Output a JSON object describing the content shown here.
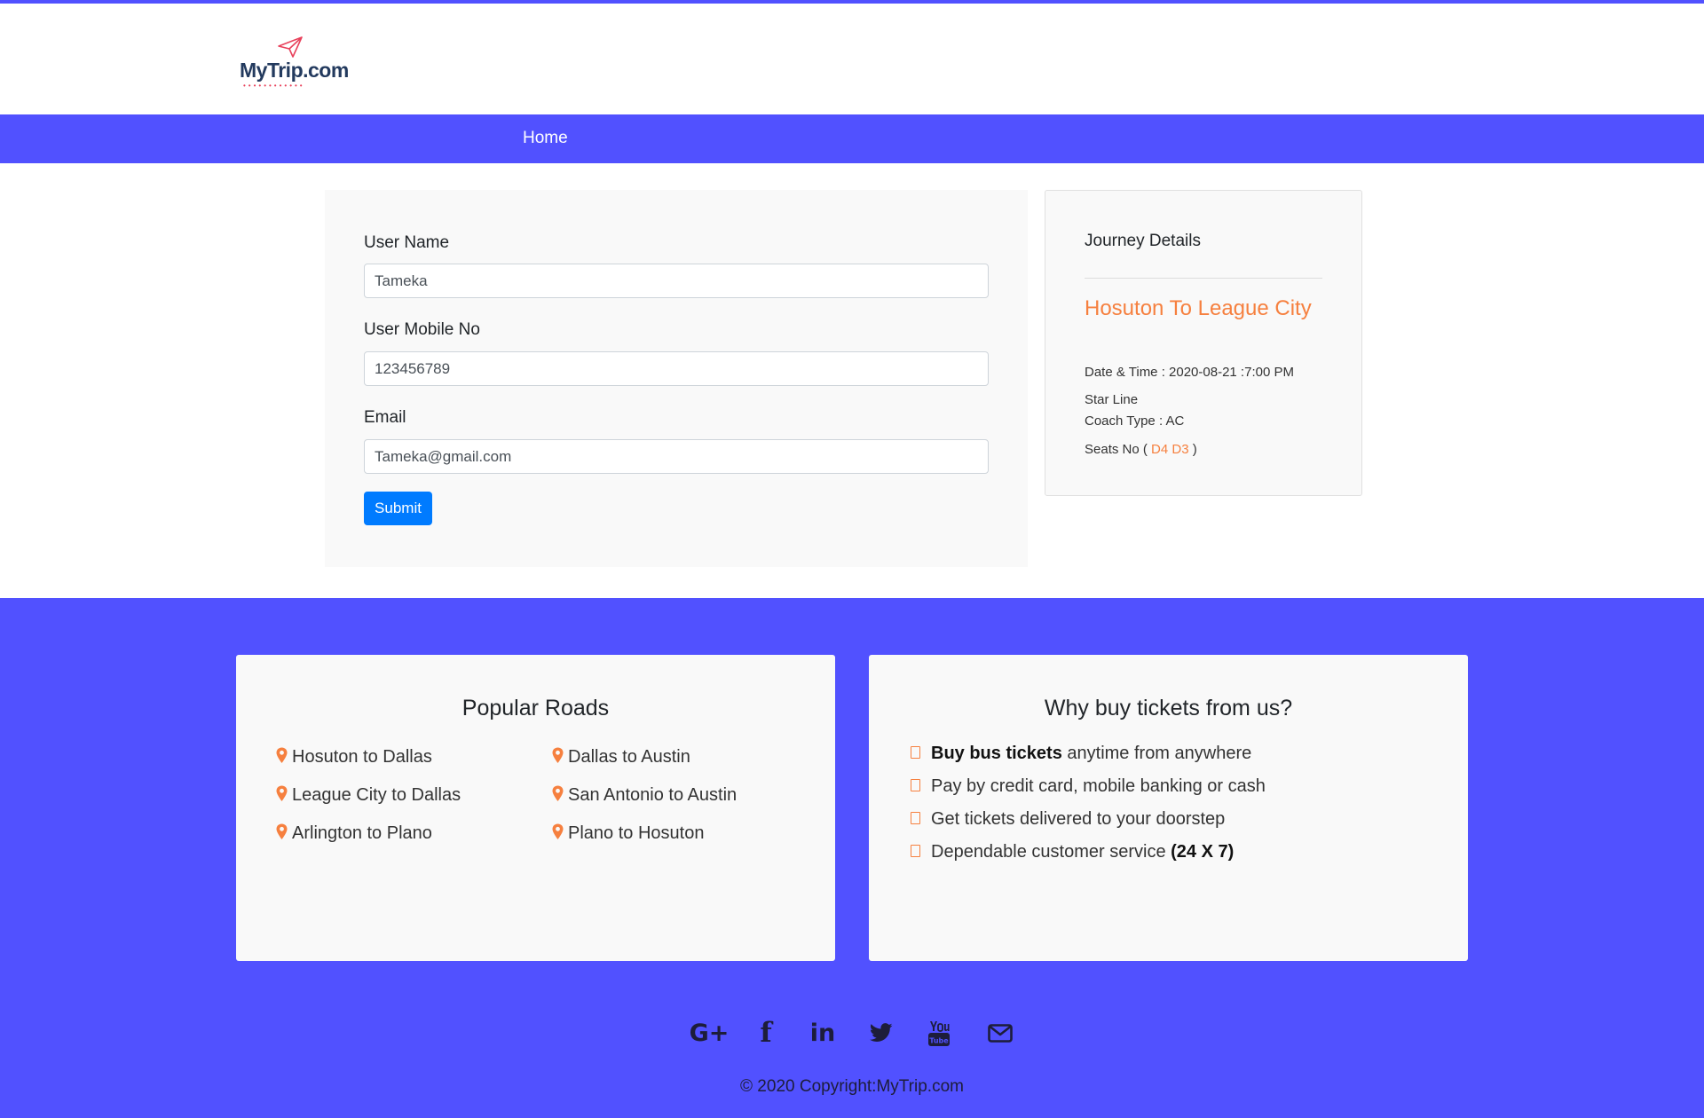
{
  "brand": {
    "logo_text": "MyTrip.com"
  },
  "nav": {
    "home_label": "Home"
  },
  "form": {
    "user_name_label": "User Name",
    "user_name_value": "Tameka",
    "mobile_label": "User Mobile No",
    "mobile_value": "123456789",
    "email_label": "Email",
    "email_value": "Tameka@gmail.com",
    "submit_label": "Submit"
  },
  "journey": {
    "title": "Journey Details",
    "route": "Hosuton To League City",
    "datetime": "Date & Time : 2020-08-21 :7:00 PM",
    "operator": "Star Line",
    "coach_type": "Coach Type : AC",
    "seats_prefix": "Seats No (",
    "seats": "D4 D3",
    "seats_suffix": ")"
  },
  "popular_roads": {
    "title": "Popular Roads",
    "items": [
      "Hosuton to Dallas",
      "Dallas to Austin",
      "League City to Dallas",
      "San Antonio to Austin",
      "Arlington to Plano",
      "Plano to Hosuton"
    ]
  },
  "why_us": {
    "title": "Why buy tickets from us?",
    "items": [
      {
        "bold": "Buy bus tickets",
        "text": " anytime from anywhere"
      },
      {
        "text": "Pay by credit card, mobile banking or cash"
      },
      {
        "text": "Get tickets delivered to your doorstep"
      },
      {
        "text": "Dependable customer service ",
        "bold_suffix": "(24 X 7)"
      }
    ]
  },
  "social": {
    "icons": [
      "google-plus-icon",
      "facebook-icon",
      "linkedin-icon",
      "twitter-icon",
      "youtube-icon",
      "email-icon"
    ],
    "gplus_glyph": "G+",
    "facebook_glyph": "f",
    "linkedin_glyph": "in"
  },
  "footer": {
    "copyright": "© 2020 Copyright:MyTrip.com"
  },
  "colors": {
    "accent": "#5151ff",
    "orange": "#f6803f",
    "button": "#007bff",
    "card_bg": "#f9f9f9"
  }
}
